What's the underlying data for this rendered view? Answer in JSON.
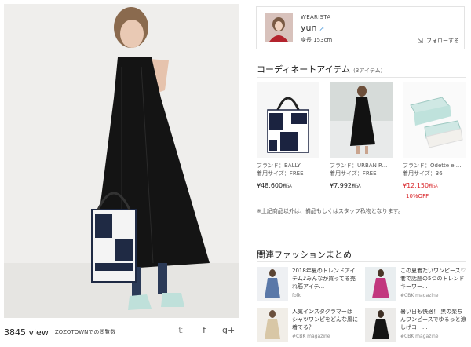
{
  "photo": {
    "views": "3845 view",
    "views_label": "ZOZOTOWNでの閲覧数",
    "share_icons": [
      "twitter-icon",
      "facebook-icon",
      "google-plus-icon"
    ],
    "share_glyphs": [
      "𝕥",
      "f",
      "g+"
    ]
  },
  "user": {
    "brand": "WEARISTA",
    "name": "yun",
    "height": "身長 153cm",
    "follow_label": "フォローする"
  },
  "coordinate": {
    "title": "コーディネートアイテム",
    "count": "(3アイテム)",
    "items": [
      {
        "brand": "ブランド：BALLY",
        "size": "着用サイズ：FREE",
        "price": "¥48,600",
        "tax": "税込",
        "sale": false,
        "off": ""
      },
      {
        "brand": "ブランド：URBAN R...",
        "size": "着用サイズ：FREE",
        "price": "¥7,992",
        "tax": "税込",
        "sale": false,
        "off": ""
      },
      {
        "brand": "ブランド：Odette e ...",
        "size": "着用サイズ：36",
        "price": "¥12,150",
        "tax": "税込",
        "sale": true,
        "off": "10%OFF"
      }
    ],
    "note": "※上記商品以外は、備品もしくはスタッフ私物となります。"
  },
  "related": {
    "title": "関連ファッションまとめ",
    "items": [
      {
        "title": "2018年夏のトレンドアイテム♪みんなが買ってる売れ筋アイテ...",
        "source": "folk"
      },
      {
        "title": "この夏着たいワンピース♡ 巷で話題の5つのトレンドキーワー...",
        "source": "#CBK magazine"
      },
      {
        "title": "人気インスタグラマーは シャツワンピをどんな風に着てる？",
        "source": "#CBK magazine"
      },
      {
        "title": "暑い日も快適！ 黒の楽ちんワンピースでゆるっと涼しげコー...",
        "source": "#CBK magazine"
      }
    ]
  }
}
